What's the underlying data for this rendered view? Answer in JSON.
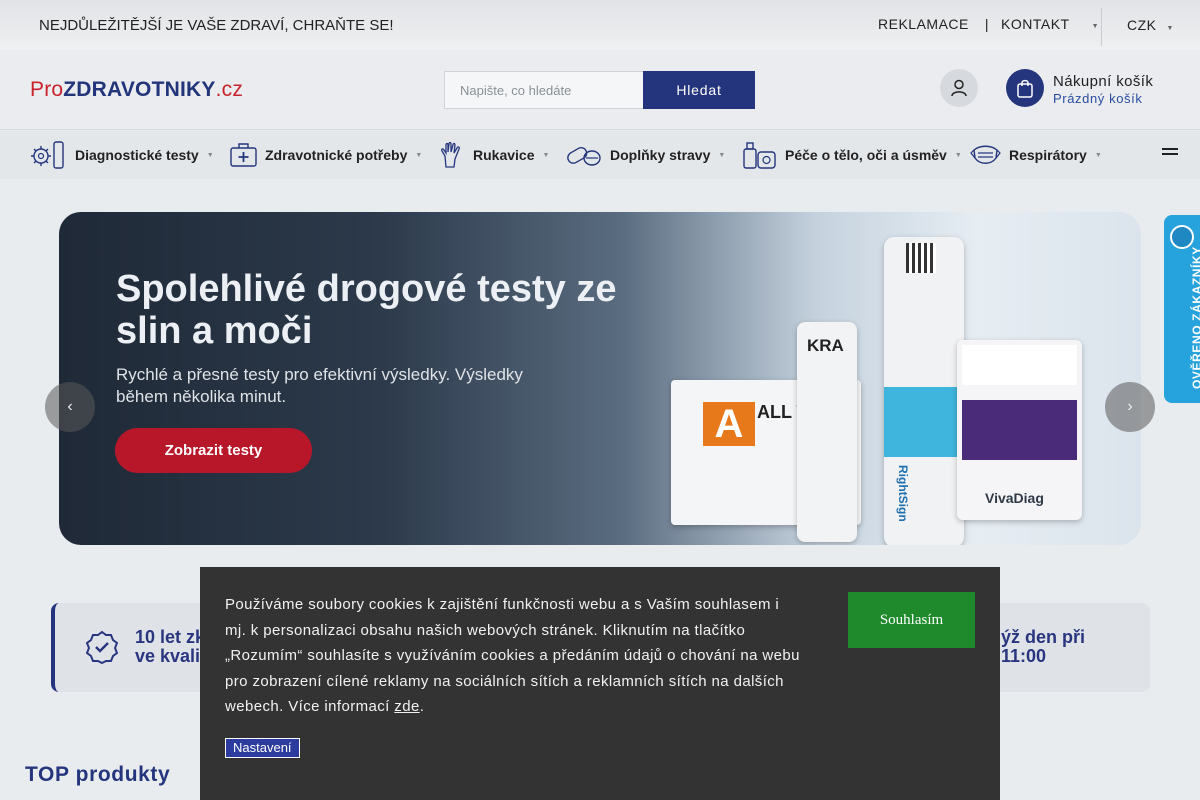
{
  "topbar": {
    "slogan": "NEJDŮLEŽITĚJŠÍ JE VAŠE ZDRAVÍ, CHRAŇTE SE!",
    "links": [
      "REKLAMACE",
      "KONTAKT"
    ],
    "separator": "|",
    "currency": "CZK"
  },
  "header": {
    "logo": {
      "pro": "Pro",
      "main": "ZDRAVOTNIKY",
      "tld": ".cz"
    },
    "search": {
      "placeholder": "Napište, co hledáte",
      "button": "Hledat"
    },
    "cart": {
      "title": "Nákupní košík",
      "status": "Prázdný košík"
    }
  },
  "nav": {
    "items": [
      {
        "label": "Diagnostické testy",
        "icon": "virus-test-icon"
      },
      {
        "label": "Zdravotnické potřeby",
        "icon": "first-aid-kit-icon"
      },
      {
        "label": "Rukavice",
        "icon": "glove-icon"
      },
      {
        "label": "Doplňky stravy",
        "icon": "pills-icon"
      },
      {
        "label": "Péče o tělo, oči a úsměv",
        "icon": "cosmetics-icon"
      },
      {
        "label": "Respirátory",
        "icon": "mask-icon"
      }
    ]
  },
  "hero": {
    "title": "Spolehlivé drogové testy ze slin a moči",
    "subtitle": "Rychlé a přesné testy pro efektivní výsledky. Výsledky během několika minut.",
    "cta": "Zobrazit testy",
    "product_labels": {
      "box_letter": "A",
      "box_text": "ALL TEST",
      "cassette": "KRA",
      "cup_brand": "RightSign",
      "card_brand": "VivaDiag"
    }
  },
  "benefits": {
    "left": "10 let zku... ve kvalit...",
    "left_lines": [
      "10 let zku",
      "ve kvalit"
    ],
    "right_lines": [
      "ýž den při",
      "11:00"
    ]
  },
  "verified_badge": "OVĚŘENO ZÁKAZNÍKY",
  "section_title": "TOP produkty",
  "cookie": {
    "text": "Používáme soubory cookies k zajištění funkčnosti webu a s Vaším souhlasem i mj. k personalizaci obsahu našich webových stránek. Kliknutím na tlačítko „Rozumím“ souhlasíte s využíváním cookies a předáním údajů o chování na webu pro zobrazení cílené reklamy na sociálních sítích a reklamních sítích na dalších webech. Více informací",
    "link": "zde",
    "suffix": ".",
    "accept": "Souhlasím",
    "settings": "Nastavení"
  },
  "colors": {
    "brand_blue": "#24357d",
    "brand_red": "#c8232c",
    "cta_red": "#b8172a",
    "accept_green": "#1f8a2c",
    "badge_blue": "#26a3dd"
  }
}
